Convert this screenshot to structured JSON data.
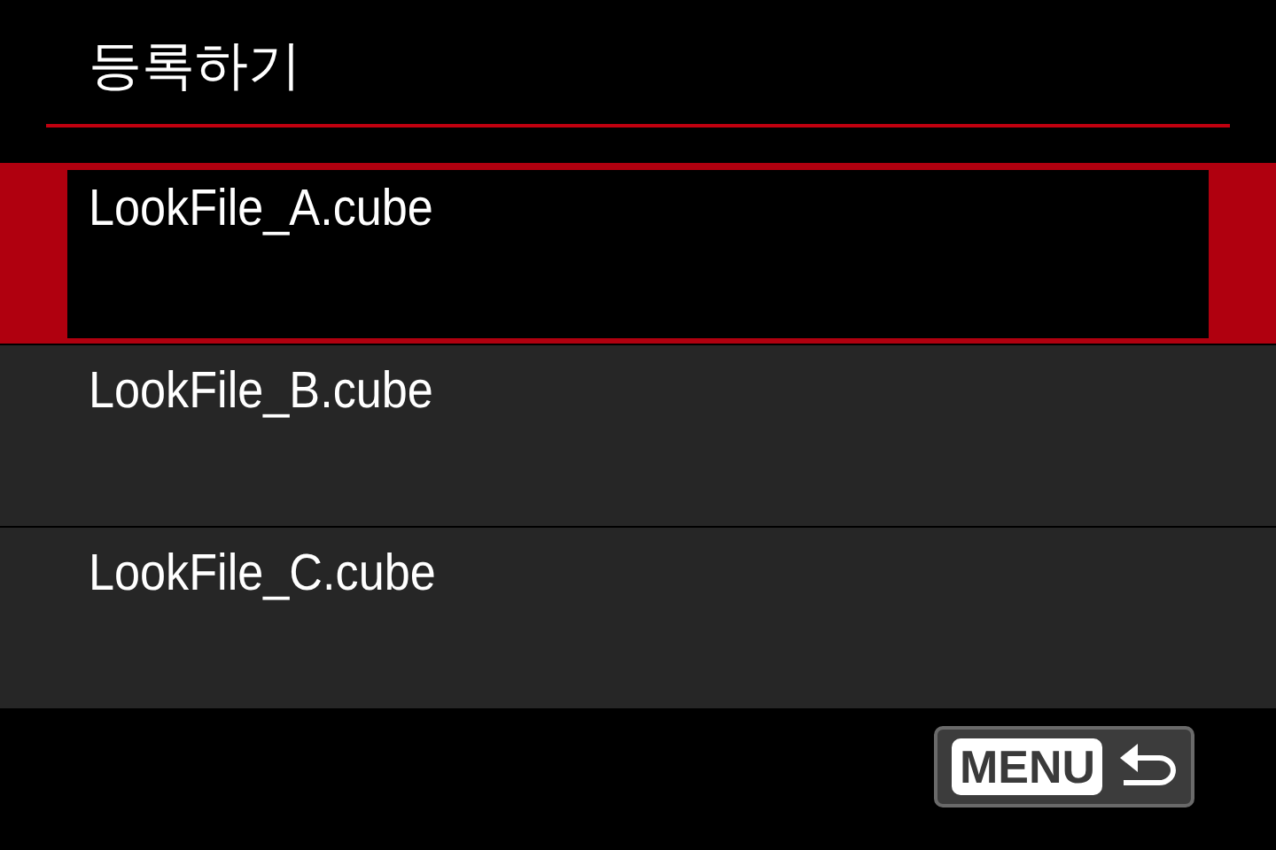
{
  "title": "등록하기",
  "items": [
    {
      "label": "LookFile_A.cube",
      "selected": true
    },
    {
      "label": "LookFile_B.cube",
      "selected": false
    },
    {
      "label": "LookFile_C.cube",
      "selected": false
    }
  ],
  "back_button": {
    "label": "MENU"
  }
}
